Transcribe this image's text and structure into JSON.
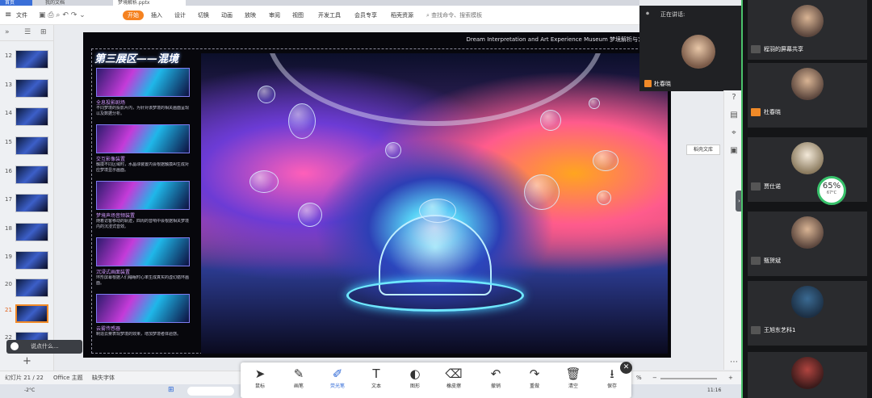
{
  "tabs": {
    "home": "首页",
    "tab2": "我的文档",
    "active": "梦境解析.pptx"
  },
  "ribbon": {
    "file": "文件",
    "start": "开始",
    "insert": "插入",
    "design": "设计",
    "transitions": "切换",
    "animation": "动画",
    "slideshow": "放映",
    "review": "审阅",
    "view": "视图",
    "devtools": "开发工具",
    "member": "会员专享",
    "resources": "稻壳资源",
    "search": "查找命令、搜索模板"
  },
  "slides": {
    "numbers": [
      "12",
      "13",
      "14",
      "15",
      "16",
      "17",
      "18",
      "19",
      "20",
      "21",
      "22"
    ],
    "active": "21"
  },
  "slide": {
    "topText": "Dream Interpretation and Art Experience Museum  梦境解析与艺术体验馆",
    "title": "第三展区——混境",
    "features": [
      {
        "title": "全息投影剧场",
        "desc": "不同梦境的投影片内，为针对该梦境的相关画面呈现以及数据分析。"
      },
      {
        "title": "交互影像装置",
        "desc": "触摸不同区域时，水晶球装置内会根据触摸AI生成对应梦境显示画面。"
      },
      {
        "title": "梦境声场音频装置",
        "desc": "随着访客移动的轨迹，四周的音响中会根据相关梦境内的沉浸式音效。"
      },
      {
        "title": "沉浸式画面装置",
        "desc": "环形屏幕根据人们睡眠时心率生成真实的虚幻循环画面。"
      },
      {
        "title": "云雾传感器",
        "desc": "制造云雾表现梦境的效果，增加梦境者体验感。"
      }
    ]
  },
  "speaker": {
    "label": "正在讲话:",
    "name": "杜春晓"
  },
  "tooltip": "稻壳文库",
  "comment": {
    "placeholder": "说点什么..."
  },
  "status": {
    "slide": "幻灯片 21 / 22",
    "theme": "Office 主题",
    "font": "缺失字体",
    "zoom": "%"
  },
  "taskbar": {
    "temp": "-2°C",
    "time": "11:16"
  },
  "pentool": {
    "mouse": "鼠标",
    "pen": "画笔",
    "highlighter": "荧光笔",
    "text": "文本",
    "shape": "图形",
    "eraser": "橡皮擦",
    "undo": "撤销",
    "redo": "重做",
    "clear": "清空",
    "save": "保存"
  },
  "participants": [
    "程羽的屏幕共享",
    "杜春晓",
    "贾仕诺",
    "甄贺斌",
    "王旭东艺科1"
  ],
  "gauge": {
    "value": "65%",
    "temp": "67°C"
  },
  "colors": {
    "accent": "#f58220",
    "active_pen": "#2a66d6",
    "green": "#4ac26b"
  }
}
